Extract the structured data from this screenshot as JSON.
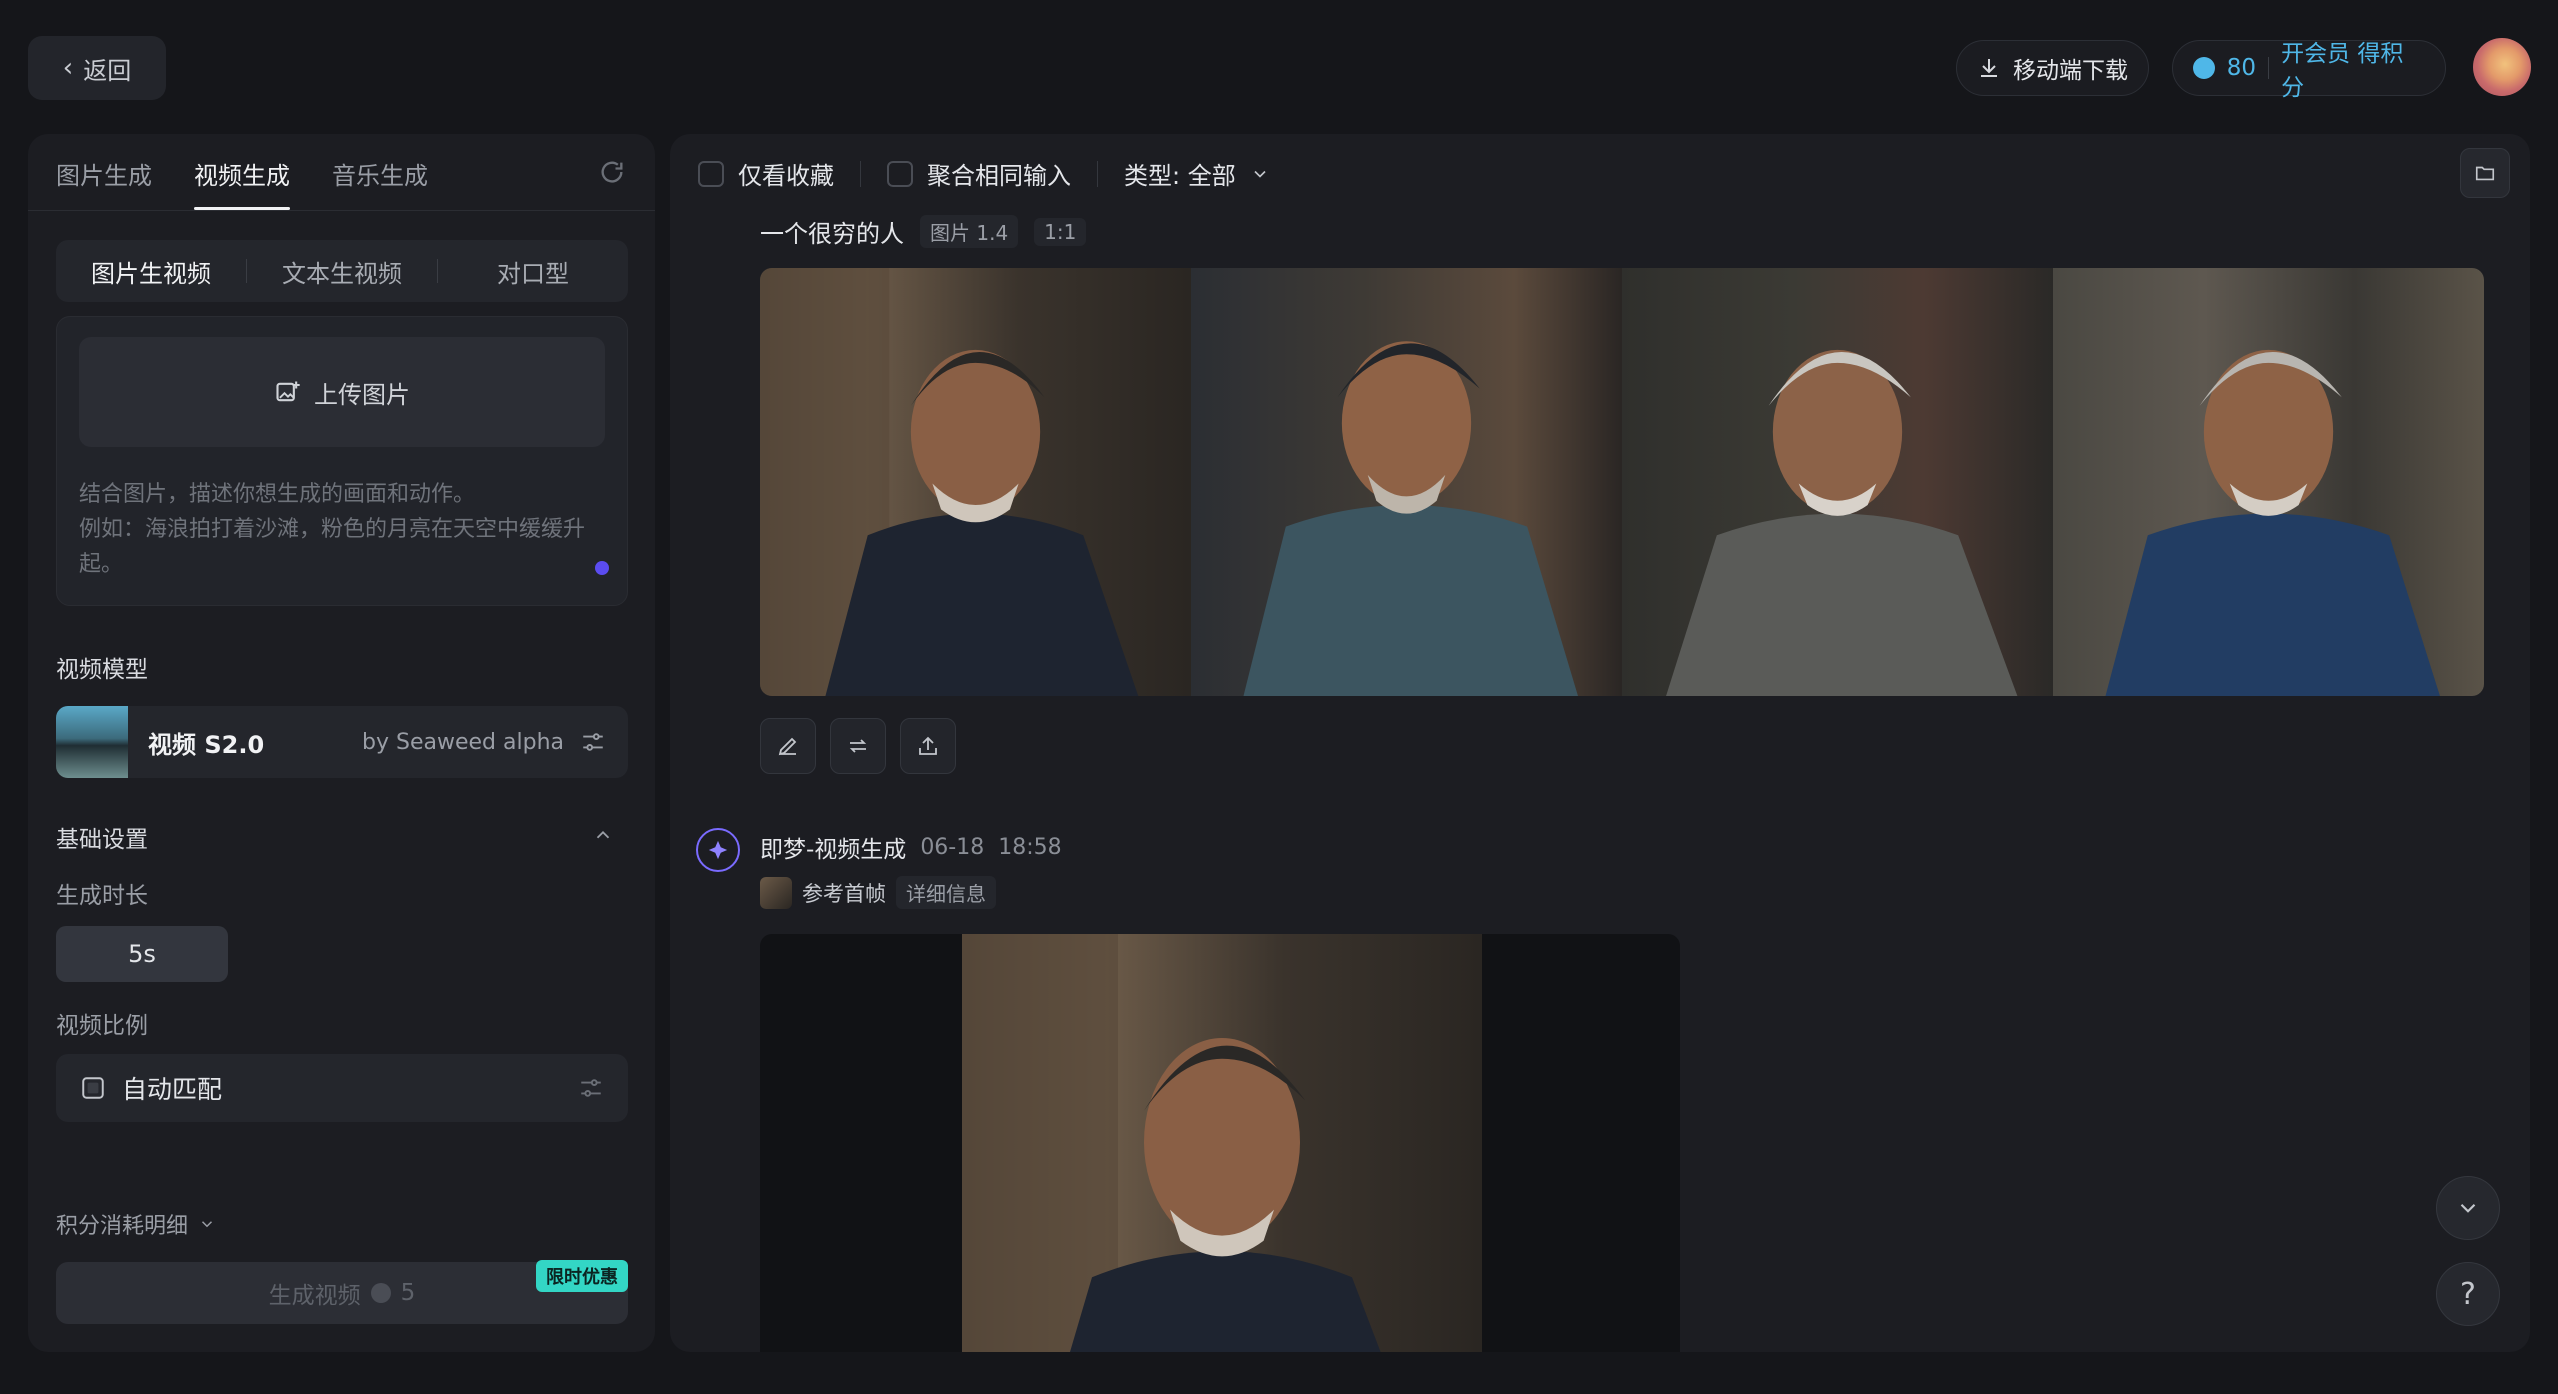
{
  "header": {
    "back_label": "返回",
    "download_label": "移动端下载",
    "points": "80",
    "member_label": "开会员 得积分"
  },
  "left": {
    "tabs": [
      {
        "label": "图片生成"
      },
      {
        "label": "视频生成"
      },
      {
        "label": "音乐生成"
      }
    ],
    "modes": [
      {
        "label": "图片生视频"
      },
      {
        "label": "文本生视频"
      },
      {
        "label": "对口型"
      }
    ],
    "upload_label": "上传图片",
    "prompt_placeholder": "结合图片，描述你想生成的画面和动作。\n例如：海浪拍打着沙滩，粉色的月亮在天空中缓缓升起。",
    "model_section": "视频模型",
    "model_name": "视频 S2.0",
    "model_by": "by Seaweed alpha",
    "basic_section": "基础设置",
    "duration_label": "生成时长",
    "duration_value": "5s",
    "ratio_label": "视频比例",
    "ratio_value": "自动匹配",
    "cost_label": "积分消耗明细",
    "generate_label": "生成视频",
    "generate_cost": "5",
    "promo_badge": "限时优惠"
  },
  "right": {
    "filter_favorites": "仅看收藏",
    "filter_merge": "聚合相同输入",
    "filter_type": "类型: 全部",
    "image_prompt": "一个很穷的人",
    "image_model": "图片 1.4",
    "image_ratio": "1:1",
    "video_source": "即梦-视频生成",
    "video_date": "06-18",
    "video_time": "18:58",
    "ref_label": "参考首帧",
    "detail_label": "详细信息"
  },
  "colors": {
    "accent": "#5b4cf0",
    "promo": "#33d6c5",
    "member": "#4fb7e8"
  }
}
